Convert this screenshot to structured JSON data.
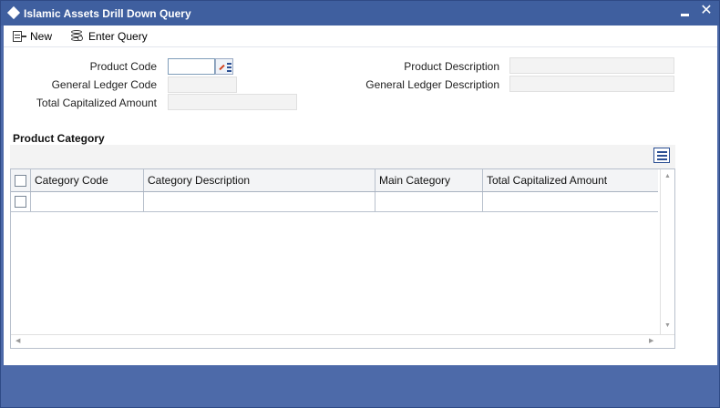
{
  "window": {
    "title": "Islamic Assets Drill Down Query",
    "minimize_glyph": "▬",
    "close_glyph": "✕"
  },
  "toolbar": {
    "new_label": "New",
    "enter_query_label": "Enter Query"
  },
  "form": {
    "product_code_label": "Product Code",
    "product_code_value": "",
    "general_ledger_code_label": "General Ledger Code",
    "general_ledger_code_value": "",
    "total_capitalized_amount_label": "Total Capitalized Amount",
    "total_capitalized_amount_value": "",
    "product_description_label": "Product Description",
    "product_description_value": "",
    "general_ledger_description_label": "General Ledger Description",
    "general_ledger_description_value": ""
  },
  "product_category": {
    "section_title": "Product Category",
    "columns": [
      "Category Code",
      "Category Description",
      "Main Category",
      "Total Capitalized Amount"
    ],
    "rows": [
      {
        "category_code": "",
        "category_description": "",
        "main_category": "",
        "total_capitalized_amount": ""
      }
    ]
  },
  "icons": {
    "title": "diamond-icon",
    "new": "new-document-icon",
    "enter_query": "query-database-icon",
    "lov": "list-of-values-icon",
    "grid_settings": "grid-columns-icon"
  },
  "colors": {
    "titlebar": "#3f5f9f",
    "frame": "#4d6aa9",
    "readonly_field": "#f3f3f3"
  }
}
